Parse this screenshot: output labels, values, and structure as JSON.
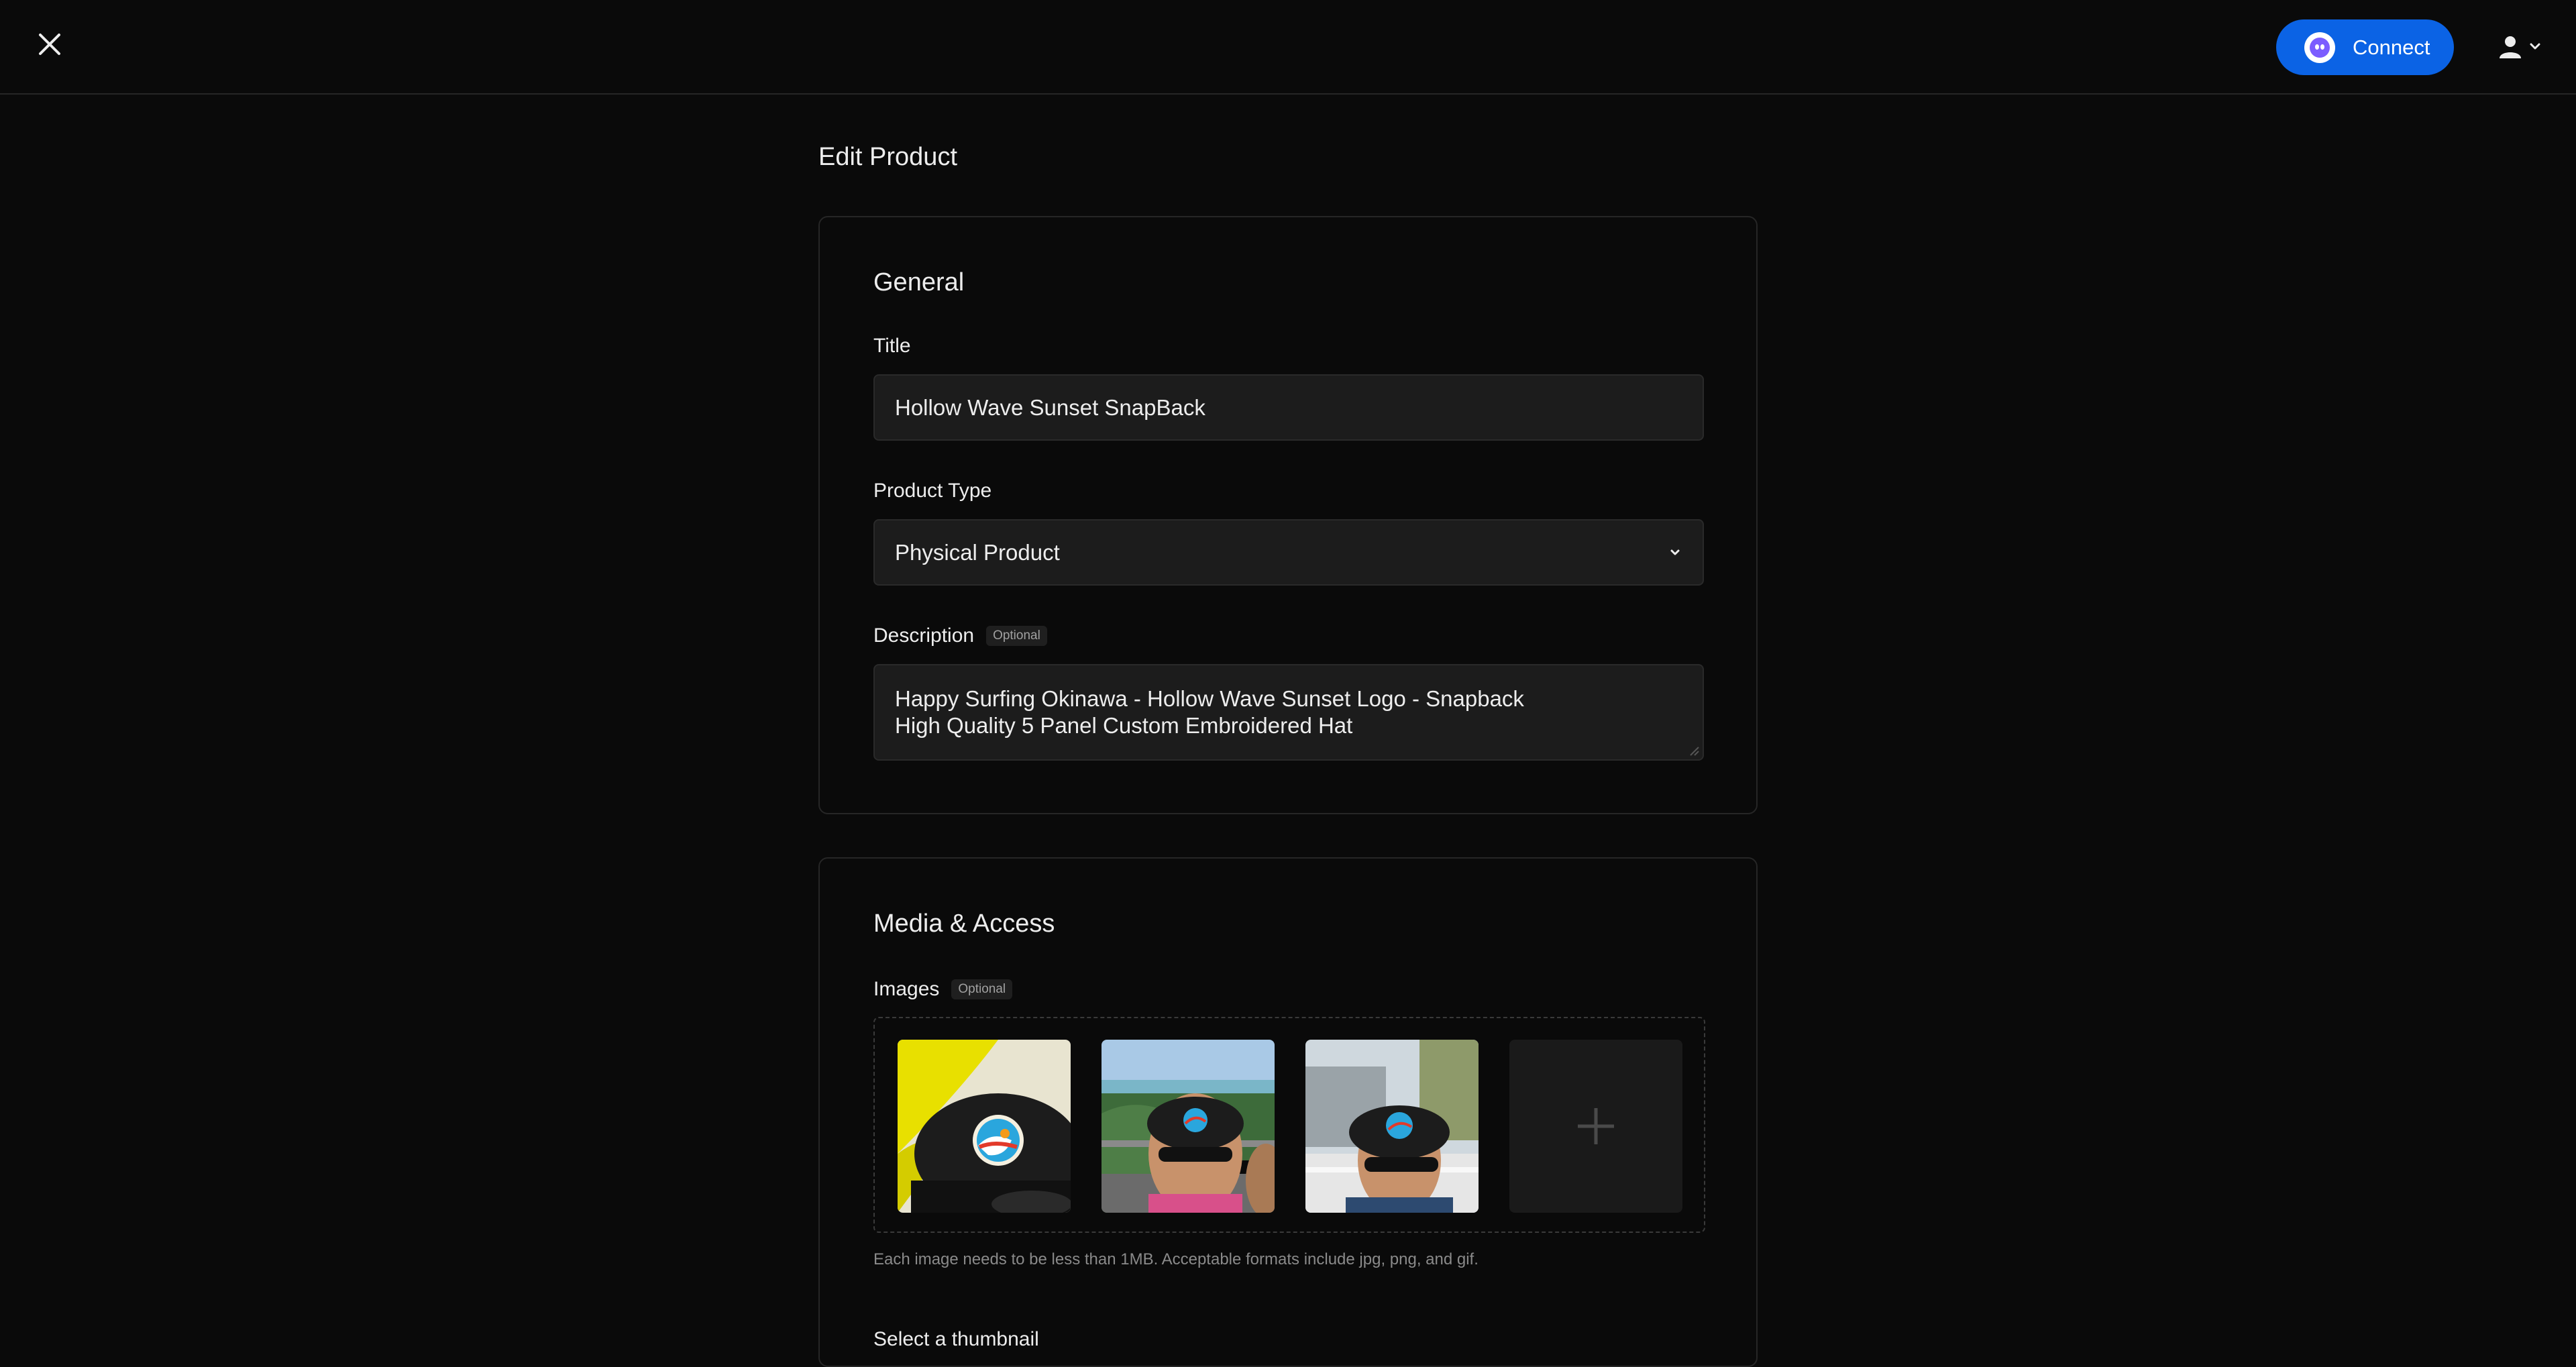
{
  "header": {
    "connect_label": "Connect"
  },
  "page": {
    "title": "Edit Product"
  },
  "general": {
    "section_title": "General",
    "title_label": "Title",
    "title_value": "Hollow Wave Sunset SnapBack",
    "product_type_label": "Product Type",
    "product_type_value": "Physical Product",
    "description_label": "Description",
    "description_optional": "Optional",
    "description_line1": "Happy Surfing Okinawa - Hollow Wave Sunset Logo - Snapback",
    "description_line2": "High Quality 5 Panel Custom Embroidered Hat"
  },
  "media": {
    "section_title": "Media & Access",
    "images_label": "Images",
    "images_optional": "Optional",
    "help_text": "Each image needs to be less than 1MB. Acceptable formats include jpg, png, and gif.",
    "next_label": "Select a thumbnail"
  },
  "icons": {
    "close": "close-icon",
    "connect": "ghost-icon",
    "user": "user-icon",
    "chevron": "chevron-down-icon",
    "add": "plus-icon"
  },
  "colors": {
    "background": "#0a0a0a",
    "accent": "#0b63e5",
    "input_bg": "#1c1c1c",
    "border": "#262626"
  }
}
